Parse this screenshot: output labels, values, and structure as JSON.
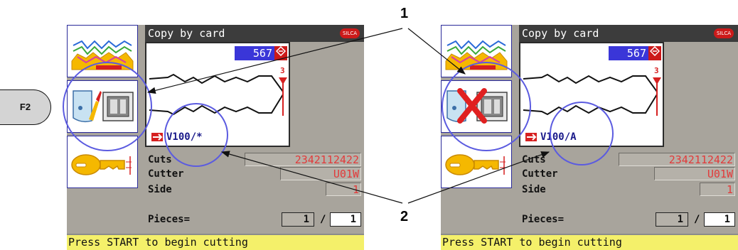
{
  "f2_button": {
    "label": "F2"
  },
  "callouts": {
    "one": "1",
    "two": "2"
  },
  "screens": [
    {
      "title": "Copy by card",
      "brand": "SILCA",
      "card_number": "567",
      "cut_marker": "3",
      "card_code": "V100/*",
      "fields": {
        "cuts_label": "Cuts",
        "cuts_value": "2342112422",
        "cutter_label": "Cutter",
        "cutter_value": "U01W",
        "side_label": "Side",
        "side_value": "1",
        "pieces_label": "Pieces=",
        "pieces_done": "1",
        "pieces_sep": "/",
        "pieces_total": "1"
      },
      "status": "Press START to begin cutting"
    },
    {
      "title": "Copy by card",
      "brand": "SILCA",
      "card_number": "567",
      "cut_marker": "3",
      "card_code": "V100/A",
      "fields": {
        "cuts_label": "Cuts",
        "cuts_value": "2342112422",
        "cutter_label": "Cutter",
        "cutter_value": "U01W",
        "side_label": "Side",
        "side_value": "1",
        "pieces_label": "Pieces=",
        "pieces_done": "1",
        "pieces_sep": "/",
        "pieces_total": "1"
      },
      "status": "Press START to begin cutting"
    }
  ],
  "colors": {
    "screen_bg": "#a8a49c",
    "title_bg": "#3c3c3c",
    "highlight_blue": "#3a36d8",
    "callout_circle": "#5b5be0",
    "status_bg": "#f4f06a",
    "value_red": "#e23a3a"
  },
  "icons": [
    "key-profile-icon",
    "copy-by-card-icon",
    "copy-card-disabled-icon",
    "key-icon"
  ]
}
